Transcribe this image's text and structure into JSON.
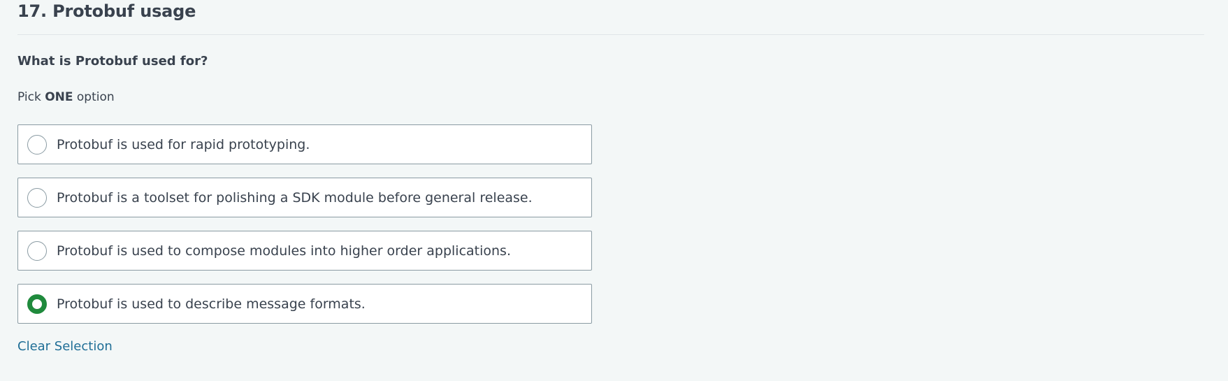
{
  "question_header": {
    "title": "17. Protobuf usage"
  },
  "question": {
    "text": "What is Protobuf used for?",
    "instruction_prefix": "Pick",
    "instruction_bold": "ONE",
    "instruction_suffix": "option"
  },
  "options": [
    {
      "label": "Protobuf is used for rapid prototyping.",
      "selected": false
    },
    {
      "label": "Protobuf is a toolset for polishing a SDK module before general release.",
      "selected": false
    },
    {
      "label": "Protobuf is used to compose modules into higher order applications.",
      "selected": false
    },
    {
      "label": "Protobuf is used to describe message formats.",
      "selected": true
    }
  ],
  "actions": {
    "clear_label": "Clear Selection"
  },
  "colors": {
    "selected_radio": "#1f8a3c",
    "link": "#1f6e96",
    "background": "#f3f7f7"
  }
}
